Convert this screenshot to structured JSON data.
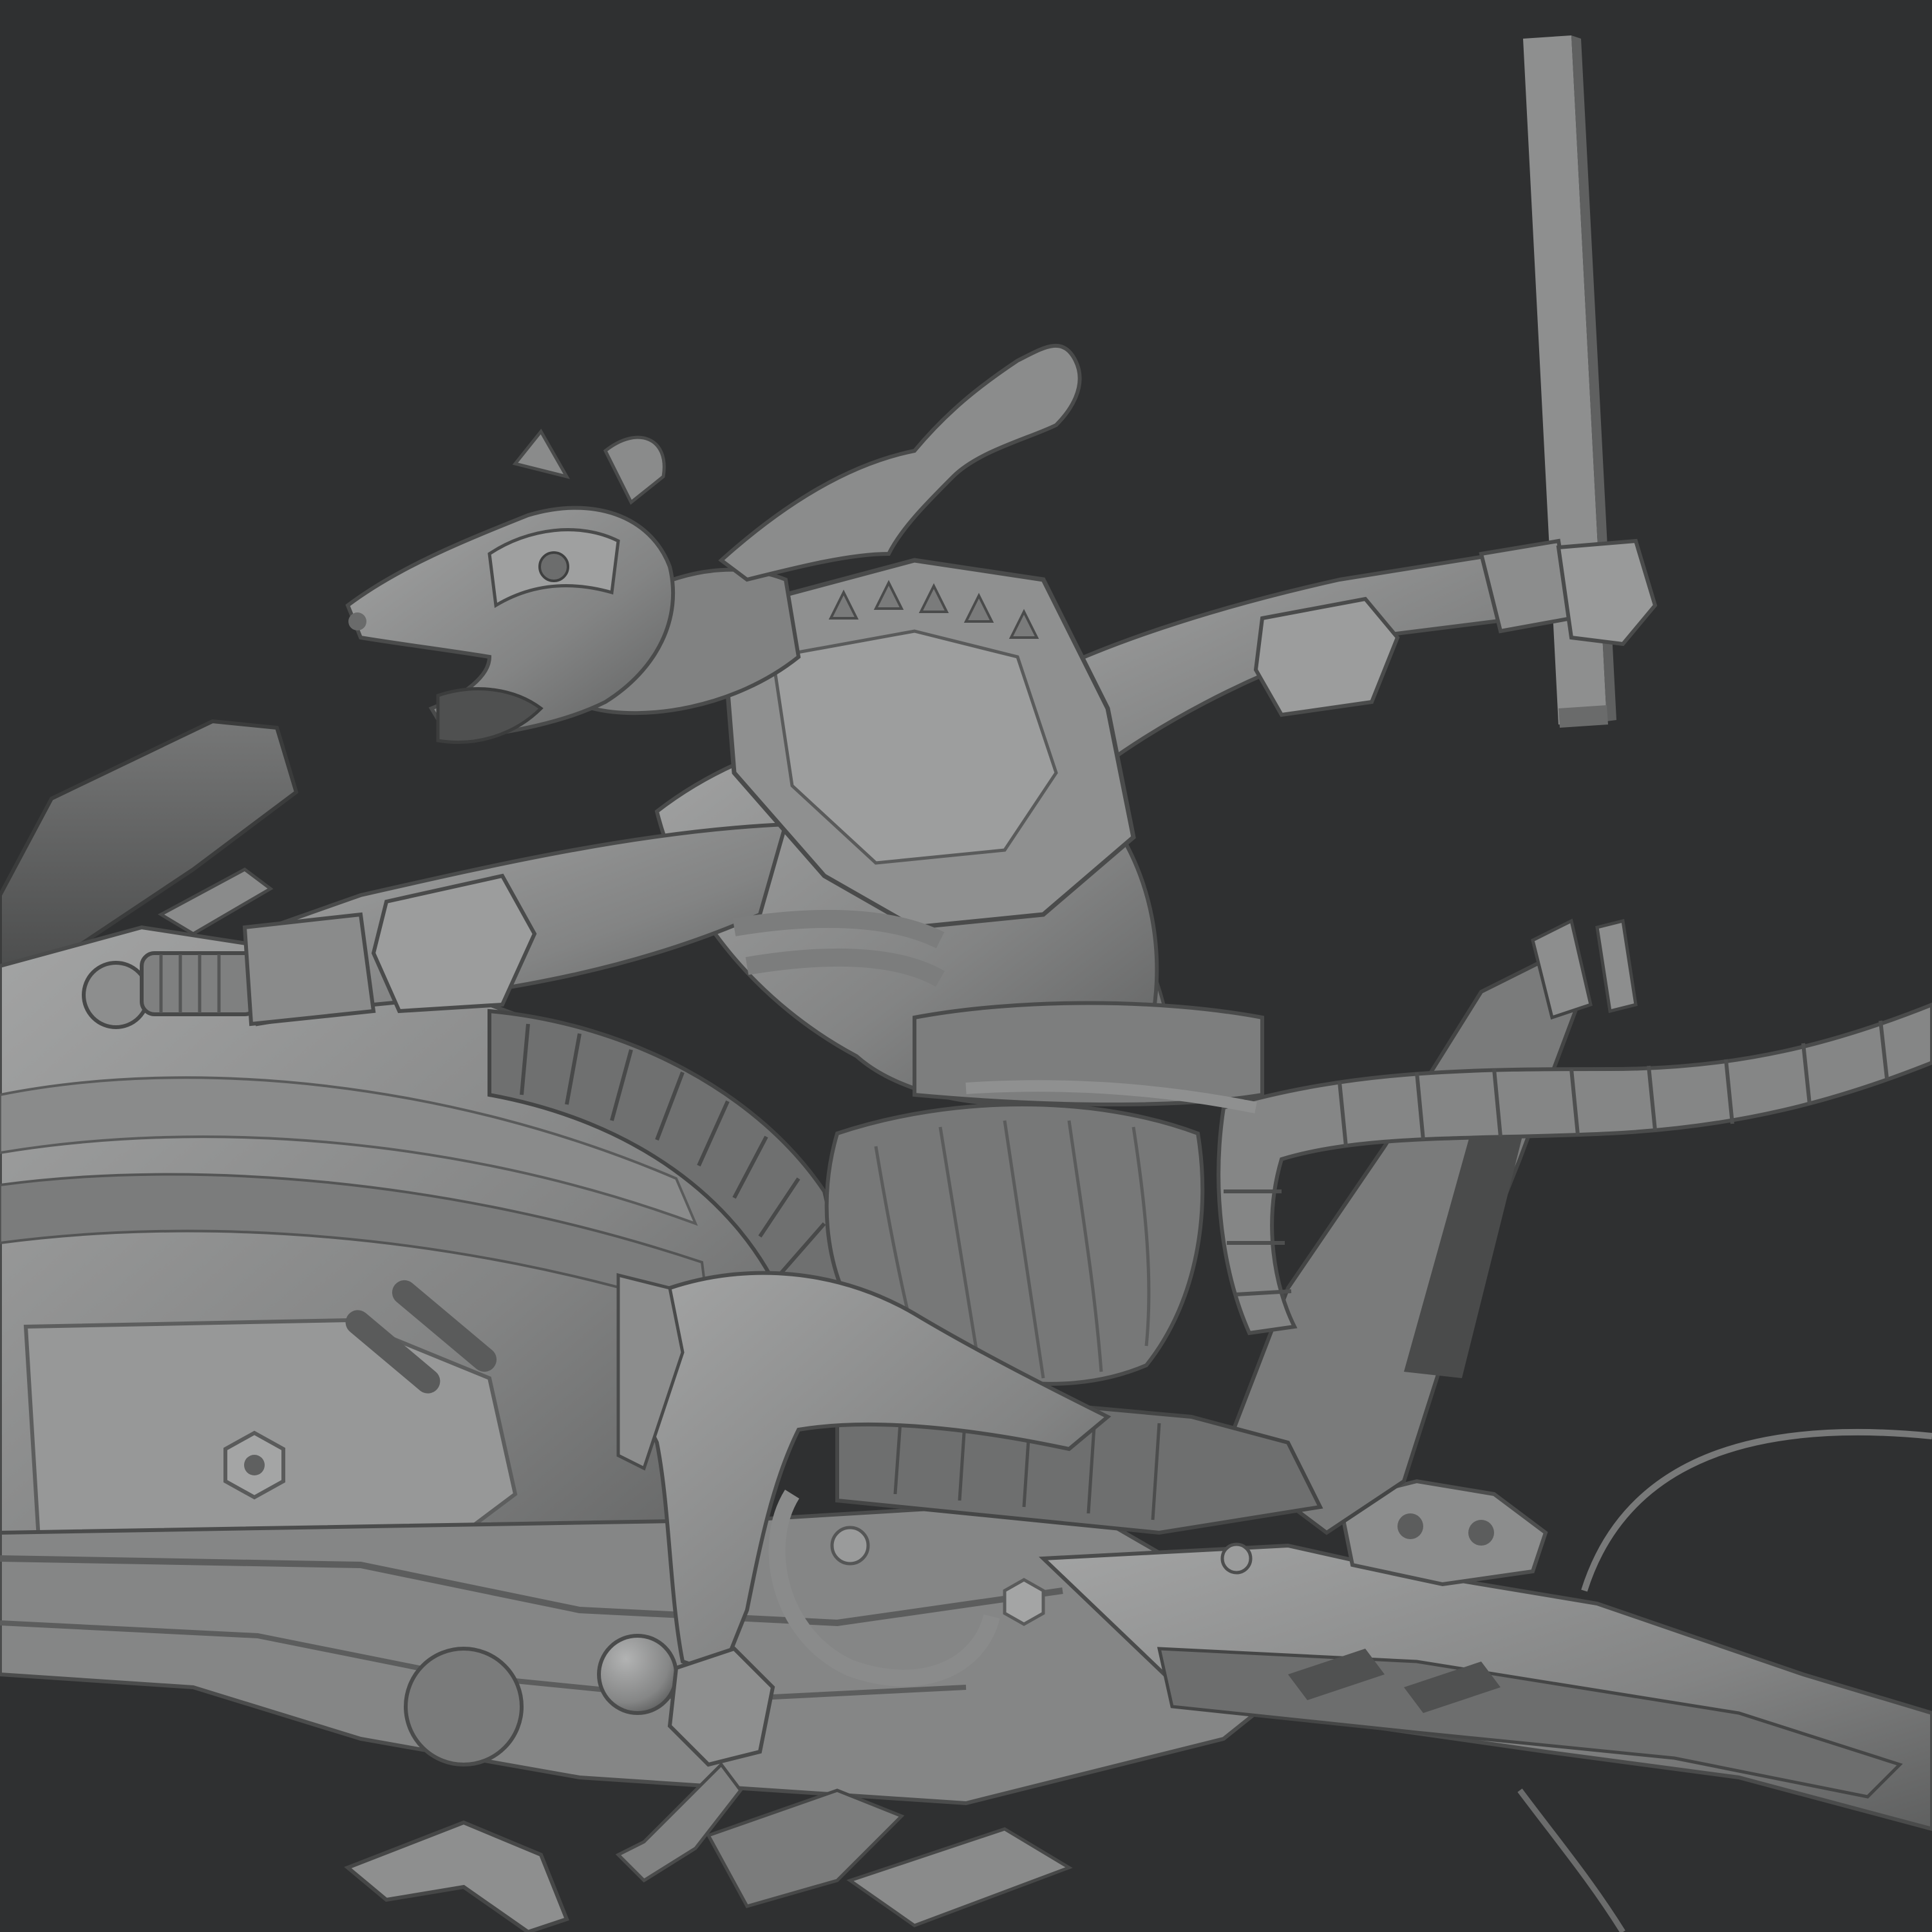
{
  "scene": {
    "description_visible_text": "",
    "colors": {
      "background": "#2f3031",
      "clay_light": "#9a9b9b",
      "clay_mid": "#7f8080",
      "clay_dark": "#5d5e5e",
      "clay_shadow": "#3f4040"
    },
    "objects": [
      "hover-bike",
      "rat-rider",
      "rider-head",
      "rider-scarf",
      "armor-chestplate",
      "front-arm",
      "raised-arm",
      "baton",
      "segmented-tail",
      "knit-waist-sash",
      "rider-leg",
      "rear-frame",
      "cable"
    ]
  }
}
